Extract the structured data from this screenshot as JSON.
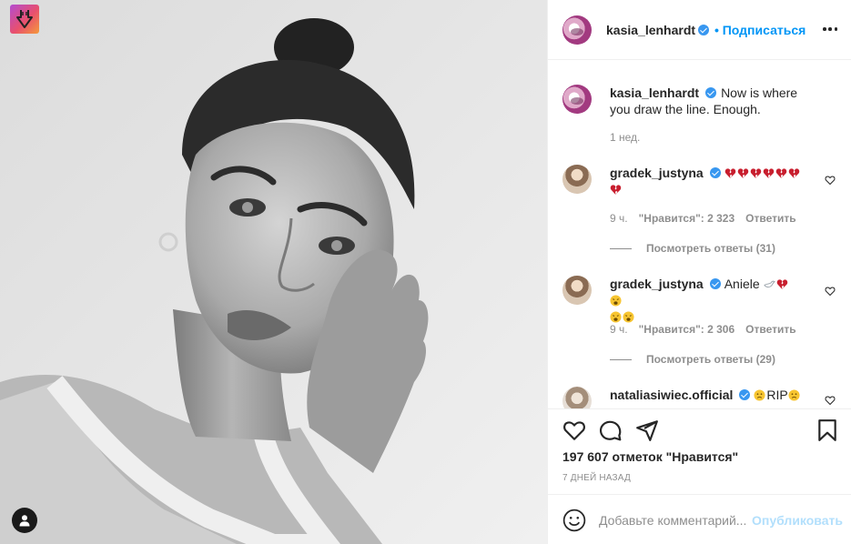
{
  "post": {
    "author": "kasia_lenhardt",
    "follow_label": "• Подписаться",
    "caption": {
      "username": "kasia_lenhardt",
      "text": "Now is where you draw the line. Enough.",
      "time": "1 нед."
    },
    "comments": [
      {
        "username": "gradek_justyna",
        "text_emojis": [
          "broken-heart",
          "broken-heart",
          "broken-heart",
          "broken-heart",
          "broken-heart",
          "broken-heart",
          "broken-heart"
        ],
        "time": "9 ч.",
        "likes": "\"Нравится\": 2 323",
        "reply_label": "Ответить",
        "view_replies": "Посмотреть ответы (31)"
      },
      {
        "username": "gradek_justyna",
        "text": "Aniele",
        "text_emojis_after": [
          "dove",
          "broken-heart",
          "weary-face",
          "weary-face",
          "weary-face"
        ],
        "time": "9 ч.",
        "likes": "\"Нравится\": 2 306",
        "reply_label": "Ответить",
        "view_replies": "Посмотреть ответы (29)"
      },
      {
        "username": "nataliasiwiec.official",
        "text": "RIP",
        "emoji_before": "frowning-face",
        "emoji_after": "frowning-face"
      }
    ],
    "likes_count": "197 607 отметок \"Нравится\"",
    "date": "7 ДНЕЙ НАЗАД",
    "add_comment": {
      "placeholder": "Добавьте комментарий...",
      "post_label": "Опубликовать"
    }
  },
  "icons": {
    "extension_badge": "download-arrow-icon",
    "tagged_user": "user-tag-icon",
    "more": "more-options-icon",
    "like": "heart-icon",
    "comment": "comment-bubble-icon",
    "share": "paper-plane-icon",
    "save": "bookmark-icon",
    "emoji": "smiley-icon"
  },
  "colors": {
    "accent": "#0095f6",
    "verified": "#3897f0",
    "post_disabled": "#b2dffc",
    "muted_text": "#8e8e8e"
  }
}
